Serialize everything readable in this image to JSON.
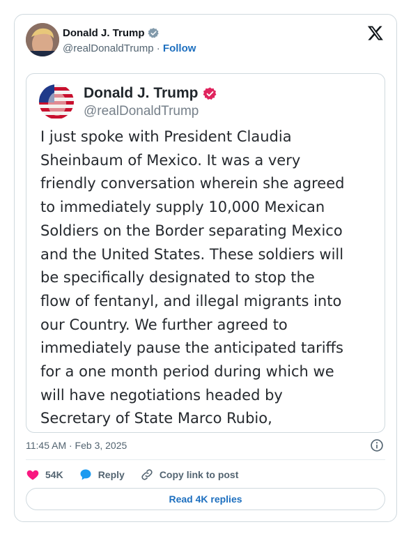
{
  "author": {
    "name": "Donald J. Trump",
    "handle": "@realDonaldTrump",
    "separator": "·",
    "follow_label": "Follow",
    "verified_icon": "verified-badge-icon",
    "badge_color": "#829aab"
  },
  "brand": {
    "logo_icon": "x-logo-icon"
  },
  "embedded_post": {
    "name": "Donald J. Trump",
    "handle": "@realDonaldTrump",
    "badge_icon": "verified-badge-icon",
    "badge_color": "#e0245e",
    "lines": [
      "I just spoke with President Claudia",
      "Sheinbaum of Mexico. It was a very",
      "friendly conversation wherein she agreed",
      "to immediately supply 10,000 Mexican",
      "Soldiers on the Border separating Mexico",
      "and the United States. These soldiers will",
      "be specifically designated to stop the",
      "flow of fentanyl, and illegal migrants into",
      "our Country. We further agreed to",
      "immediately pause the anticipated tariffs",
      "for a one month period during which we",
      "will have negotiations headed by",
      "Secretary of State Marco Rubio,"
    ]
  },
  "meta": {
    "timestamp": "11:45 AM · Feb 3, 2025",
    "info_icon": "info-icon"
  },
  "actions": {
    "like_count": "54K",
    "reply_label": "Reply",
    "copy_label": "Copy link to post",
    "like_color": "#f91880",
    "reply_color": "#1d9bf0"
  },
  "footer": {
    "read_replies_label": "Read 4K replies"
  }
}
